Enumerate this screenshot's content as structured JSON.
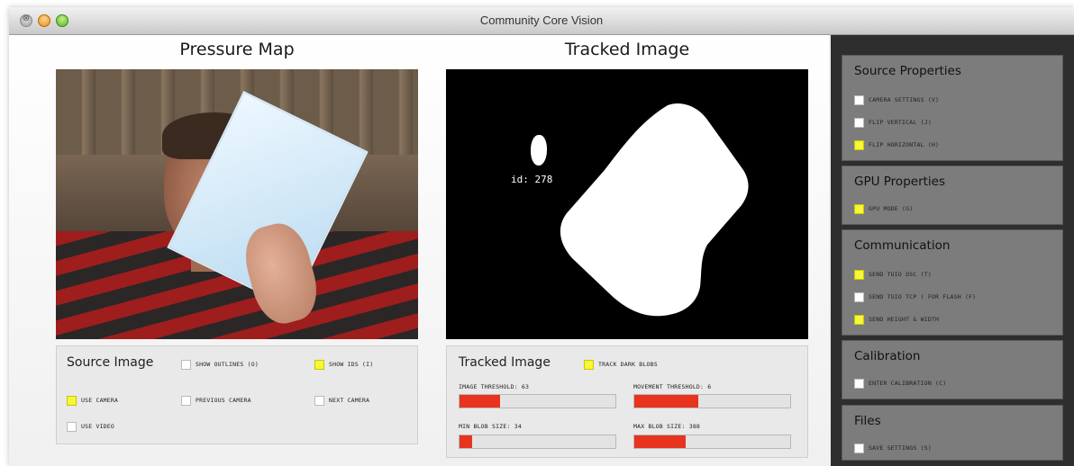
{
  "window": {
    "title": "Community Core Vision",
    "close_glyph": "⊗"
  },
  "pressure_map": {
    "title": "Pressure Map"
  },
  "tracked_image": {
    "title": "Tracked Image",
    "blob_label": "id: 278"
  },
  "source_panel": {
    "title": "Source Image",
    "options": [
      {
        "label": "SHOW OUTLINES (O)",
        "checked": false
      },
      {
        "label": "SHOW IDS (I)",
        "checked": true
      },
      {
        "label": "USE CAMERA",
        "checked": true
      },
      {
        "label": "PREVIOUS CAMERA",
        "checked": false
      },
      {
        "label": "NEXT CAMERA",
        "checked": false
      },
      {
        "label": "USE VIDEO",
        "checked": false
      }
    ]
  },
  "tracked_panel": {
    "title": "Tracked Image",
    "track_option": {
      "label": "TRACK DARK BLOBS",
      "checked": true
    },
    "sliders": [
      {
        "label": "IMAGE THRESHOLD: 63",
        "value": 63,
        "fraction": 0.26
      },
      {
        "label": "MOVEMENT THRESHOLD: 6",
        "value": 6,
        "fraction": 0.41
      },
      {
        "label": "MIN BLOB SIZE: 34",
        "value": 34,
        "fraction": 0.08
      },
      {
        "label": "MAX BLOB SIZE: 388",
        "value": 388,
        "fraction": 0.33
      }
    ]
  },
  "sidebar": {
    "groups": [
      {
        "title": "Source Properties",
        "options": [
          {
            "label": "CAMERA SETTINGS (V)",
            "checked": false
          },
          {
            "label": "FLIP VERTICAL (J)",
            "checked": false
          },
          {
            "label": "FLIP HORIZONTAL (H)",
            "checked": true
          }
        ]
      },
      {
        "title": "GPU Properties",
        "options": [
          {
            "label": "GPU MODE (G)",
            "checked": true
          }
        ]
      },
      {
        "title": "Communication",
        "options": [
          {
            "label": "SEND TUIO OSC (T)",
            "checked": true
          },
          {
            "label": "SEND TUIO TCP ( FOR FLASH (F)",
            "checked": false
          },
          {
            "label": "SEND HEIGHT & WIDTH",
            "checked": true
          }
        ]
      },
      {
        "title": "Calibration",
        "options": [
          {
            "label": "ENTER CALIBRATION (C)",
            "checked": false
          }
        ]
      },
      {
        "title": "Files",
        "options": [
          {
            "label": "SAVE SETTINGS (S)",
            "checked": false
          }
        ]
      }
    ]
  },
  "colors": {
    "checkbox_on": "#f6f63a",
    "slider_fill": "#e8331f",
    "sidebar_bg": "#2e2e2e",
    "group_bg": "#7c7c7c"
  }
}
